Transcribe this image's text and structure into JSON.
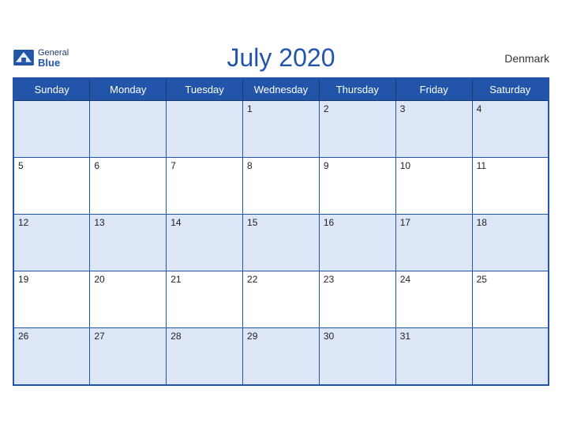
{
  "header": {
    "month_year": "July 2020",
    "country": "Denmark",
    "logo_general": "General",
    "logo_blue": "Blue"
  },
  "days_of_week": [
    "Sunday",
    "Monday",
    "Tuesday",
    "Wednesday",
    "Thursday",
    "Friday",
    "Saturday"
  ],
  "weeks": [
    [
      null,
      null,
      null,
      1,
      2,
      3,
      4
    ],
    [
      5,
      6,
      7,
      8,
      9,
      10,
      11
    ],
    [
      12,
      13,
      14,
      15,
      16,
      17,
      18
    ],
    [
      19,
      20,
      21,
      22,
      23,
      24,
      25
    ],
    [
      26,
      27,
      28,
      29,
      30,
      31,
      null
    ]
  ]
}
